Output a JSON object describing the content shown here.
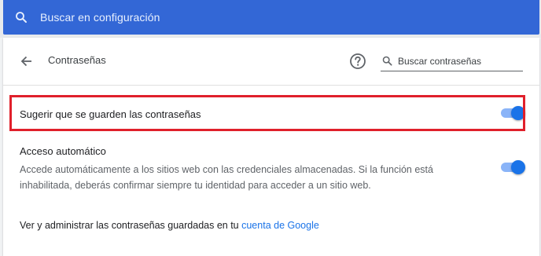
{
  "search": {
    "placeholder": "Buscar en configuración"
  },
  "header": {
    "title": "Contraseñas",
    "search_placeholder": "Buscar contraseñas"
  },
  "settings": {
    "offer_to_save": {
      "label": "Sugerir que se guarden las contraseñas",
      "enabled": true
    },
    "auto_signin": {
      "label": "Acceso automático",
      "description": "Accede automáticamente a los sitios web con las credenciales almacenadas. Si la función está inhabilitada, deberás confirmar siempre tu identidad para acceder a un sitio web.",
      "enabled": true
    }
  },
  "manage": {
    "text": "Ver y administrar las contraseñas guardadas en tu ",
    "link": "cuenta de Google"
  },
  "colors": {
    "search_bar": "#3367d6",
    "toggle_on": "#1a73e8",
    "highlight": "#e0202b",
    "link": "#1a73e8"
  }
}
